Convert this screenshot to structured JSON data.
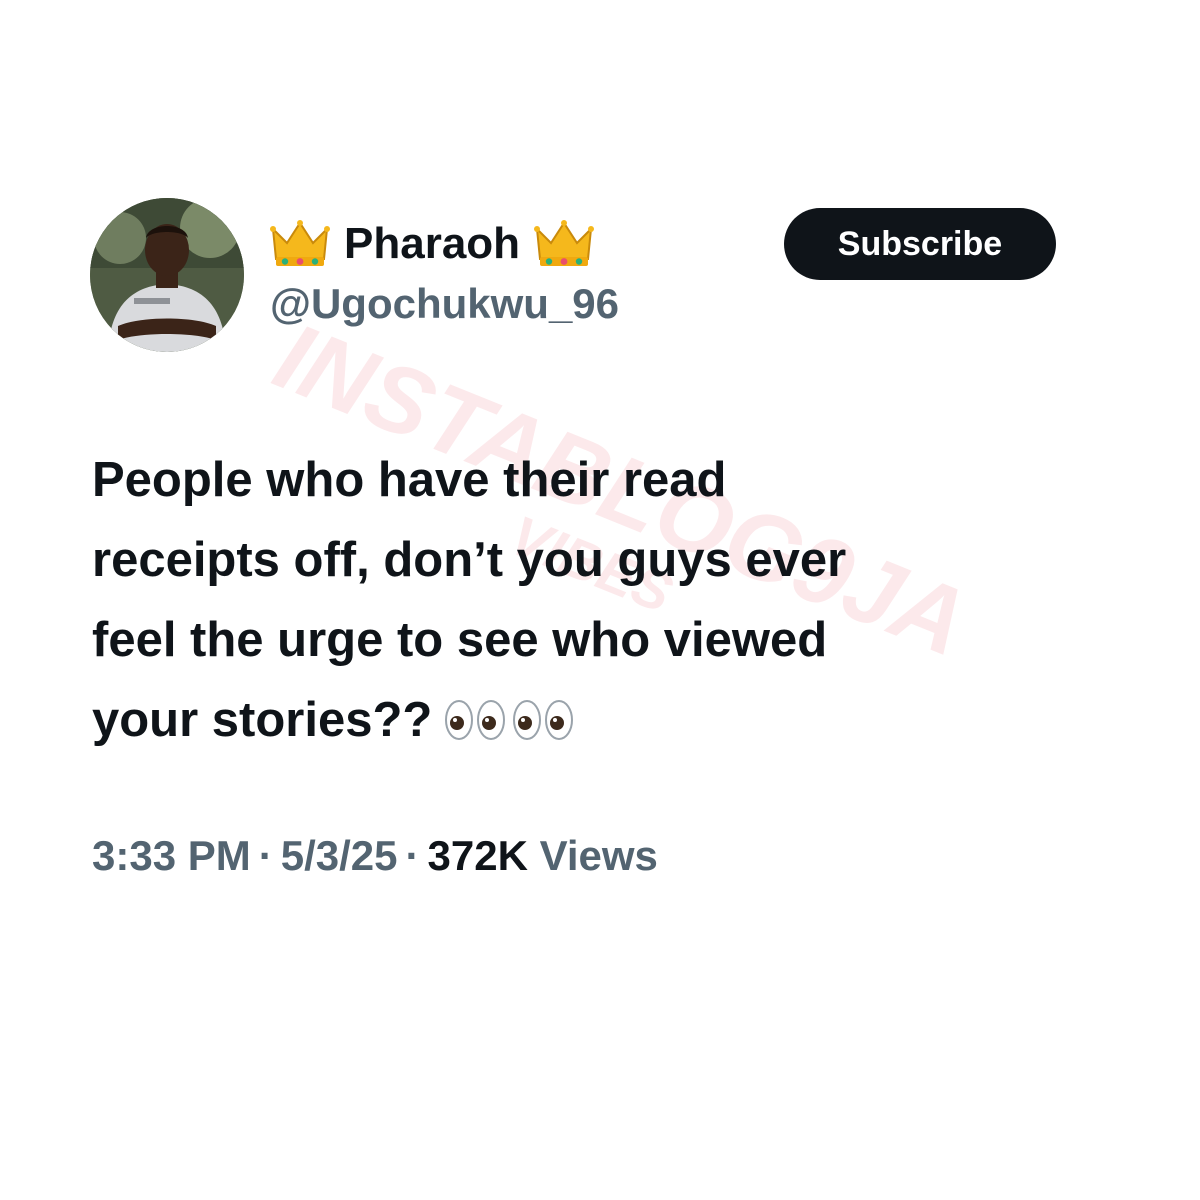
{
  "author": {
    "display_name": "Pharaoh",
    "handle": "@Ugochukwu_96",
    "name_prefix_icon": "crown-emoji",
    "name_suffix_icon": "crown-emoji",
    "avatar_icon": "profile-photo"
  },
  "subscribe_button": {
    "label": "Subscribe"
  },
  "watermark": {
    "text": "INSTABLOG9JA",
    "subtext": "VIBES"
  },
  "tweet": {
    "lines": [
      "People who have their read",
      "receipts off, don’t you guys ever",
      "feel the urge to see who viewed",
      "your stories??"
    ],
    "trailing_emoji": [
      "eyes-emoji",
      "eyes-emoji"
    ]
  },
  "meta": {
    "time": "3:33 PM",
    "separator": "·",
    "date": "5/3/25",
    "views_count": "372K",
    "views_label": "Views"
  },
  "colors": {
    "text_primary": "#0f1419",
    "text_secondary": "#536471",
    "button_bg": "#0f1419",
    "button_text": "#ffffff",
    "watermark": "#e74c5a"
  }
}
